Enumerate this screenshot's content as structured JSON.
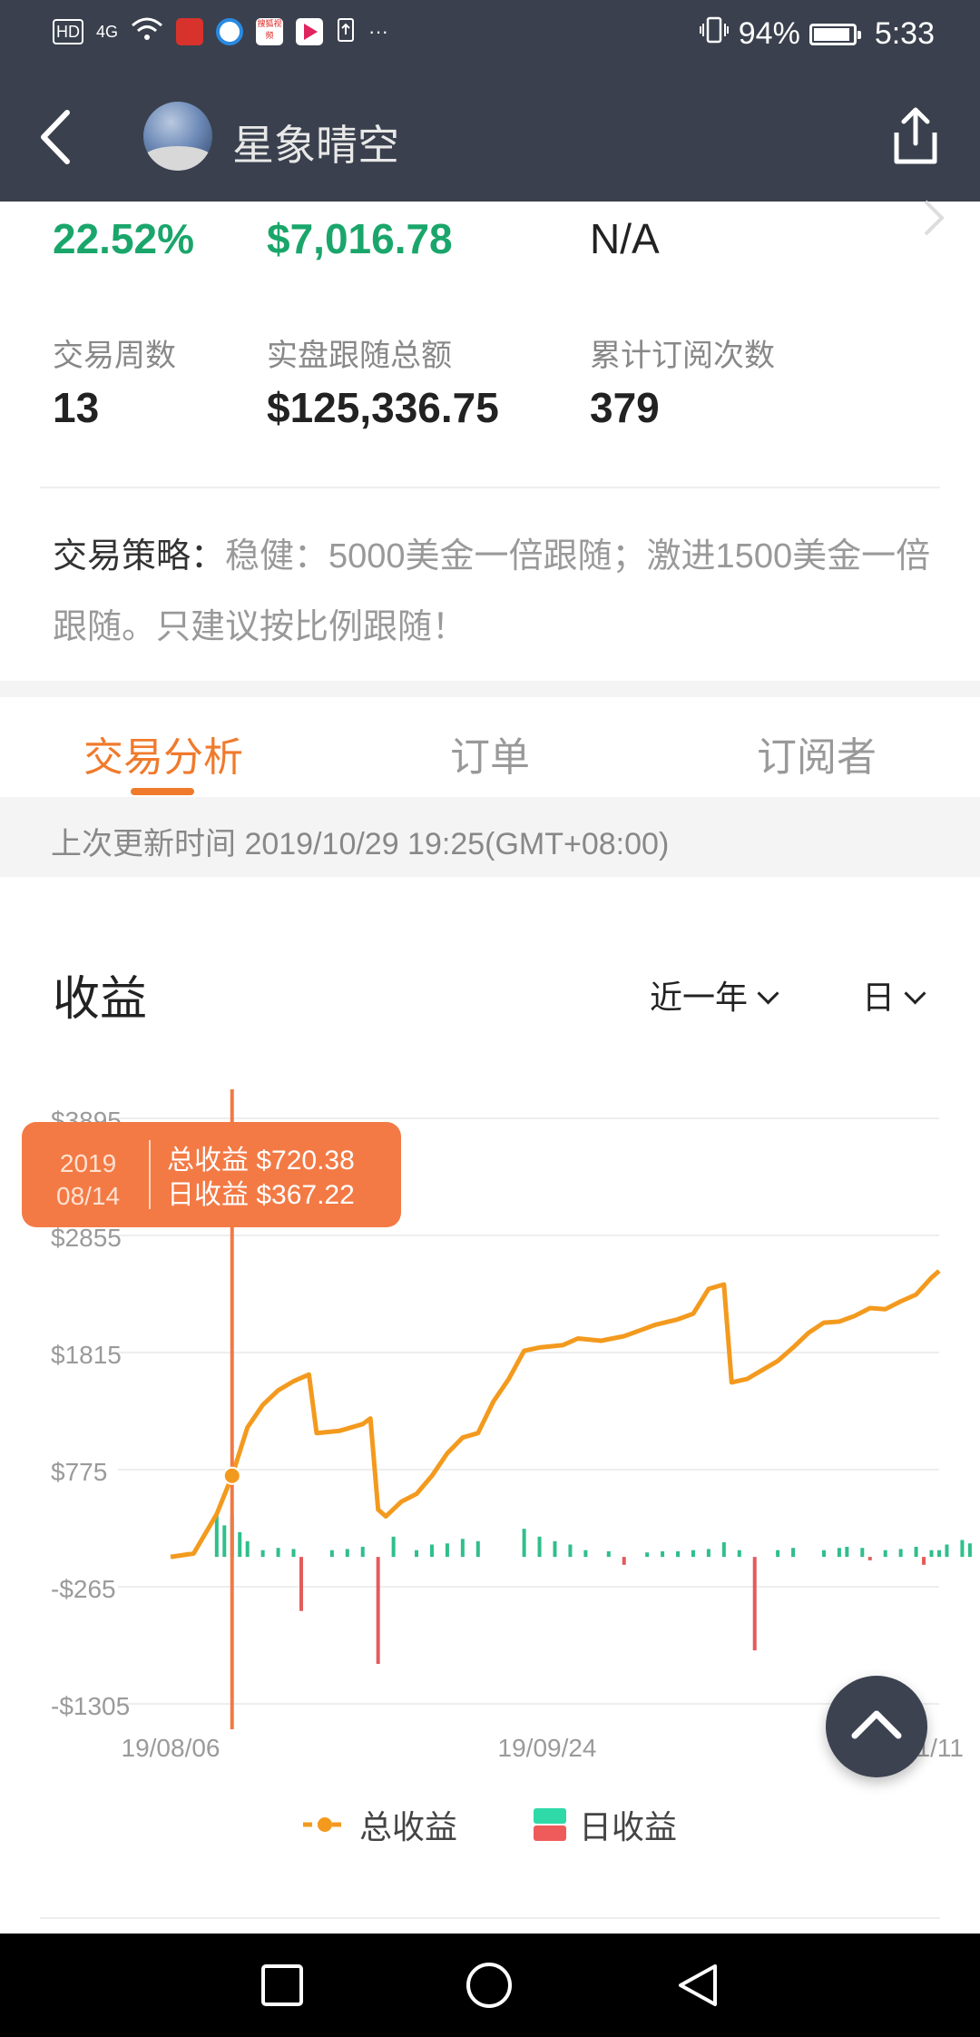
{
  "status_bar": {
    "left_icons": [
      "hd-icon",
      "4g-signal-icon",
      "wifi-icon",
      "stock-app-icon",
      "browser-app-icon",
      "sohu-video-icon",
      "video-app-icon",
      "upload-icon",
      "more-dots-icon"
    ],
    "left_labels": {
      "hd": "HD",
      "net": "4G",
      "sohu": "搜狐视频",
      "more": "···"
    },
    "battery_percent": "94%",
    "battery_level": 0.94,
    "time": "5:33"
  },
  "header": {
    "title": "星象晴空"
  },
  "stats": {
    "row1": [
      "22.52%",
      "$7,016.78",
      "N/A"
    ],
    "row2": [
      {
        "label": "交易周数",
        "value": "13"
      },
      {
        "label": "实盘跟随总额",
        "value": "$125,336.75"
      },
      {
        "label": "累计订阅次数",
        "value": "379"
      }
    ]
  },
  "strategy": {
    "label": "交易策略：",
    "text": "稳健：5000美金一倍跟随；激进1500美金一倍跟随。只建议按比例跟随！"
  },
  "tabs": [
    {
      "label": "交易分析",
      "active": true
    },
    {
      "label": "订单",
      "active": false
    },
    {
      "label": "订阅者",
      "active": false
    }
  ],
  "update_time": "上次更新时间 2019/10/29 19:25(GMT+08:00)",
  "section": {
    "title": "收益",
    "range_select": "近一年",
    "unit_select": "日"
  },
  "tooltip": {
    "date_year": "2019",
    "date_md": "08/14",
    "total_line": "总收益 $720.38",
    "daily_line": "日收益 $367.22"
  },
  "chart_data": {
    "type": "line",
    "y_ticks": [
      "$3895",
      "$2855",
      "$1815",
      "$775",
      "-$265",
      "-$1305"
    ],
    "ylim": [
      -1305,
      3895
    ],
    "x_ticks": [
      "19/08/06",
      "19/09/24",
      "19/11/11"
    ],
    "series": [
      {
        "name": "总收益",
        "color": "#f39a1e",
        "points": [
          [
            "08/06",
            0
          ],
          [
            "08/09",
            30
          ],
          [
            "08/12",
            380
          ],
          [
            "08/14",
            720
          ],
          [
            "08/16",
            1150
          ],
          [
            "08/18",
            1350
          ],
          [
            "08/20",
            1480
          ],
          [
            "08/22",
            1560
          ],
          [
            "08/24",
            1620
          ],
          [
            "08/25",
            1100
          ],
          [
            "08/28",
            1120
          ],
          [
            "08/31",
            1180
          ],
          [
            "09/01",
            1230
          ],
          [
            "09/02",
            420
          ],
          [
            "09/03",
            360
          ],
          [
            "09/05",
            490
          ],
          [
            "09/07",
            560
          ],
          [
            "09/09",
            720
          ],
          [
            "09/11",
            920
          ],
          [
            "09/13",
            1060
          ],
          [
            "09/15",
            1100
          ],
          [
            "09/17",
            1380
          ],
          [
            "09/19",
            1580
          ],
          [
            "09/21",
            1830
          ],
          [
            "09/23",
            1860
          ],
          [
            "09/26",
            1880
          ],
          [
            "09/28",
            1940
          ],
          [
            "10/01",
            1920
          ],
          [
            "10/04",
            1960
          ],
          [
            "10/06",
            2010
          ],
          [
            "10/08",
            2060
          ],
          [
            "10/11",
            2110
          ],
          [
            "10/13",
            2160
          ],
          [
            "10/15",
            2380
          ],
          [
            "10/17",
            2420
          ],
          [
            "10/18",
            1550
          ],
          [
            "10/20",
            1580
          ],
          [
            "10/22",
            1660
          ],
          [
            "10/24",
            1740
          ],
          [
            "10/26",
            1860
          ],
          [
            "10/28",
            1990
          ],
          [
            "10/30",
            2080
          ],
          [
            "11/01",
            2090
          ],
          [
            "11/03",
            2140
          ],
          [
            "11/05",
            2210
          ],
          [
            "11/07",
            2200
          ],
          [
            "11/09",
            2270
          ],
          [
            "11/11",
            2330
          ],
          [
            "11/13",
            2480
          ],
          [
            "11/14",
            2540
          ]
        ]
      },
      {
        "name": "日收益",
        "color_pos": "#2fbf8b",
        "color_neg": "#e35b5b",
        "bars": [
          [
            "08/12",
            370
          ],
          [
            "08/13",
            280
          ],
          [
            "08/14",
            367
          ],
          [
            "08/15",
            220
          ],
          [
            "08/16",
            140
          ],
          [
            "08/18",
            60
          ],
          [
            "08/20",
            80
          ],
          [
            "08/22",
            70
          ],
          [
            "08/23",
            -480
          ],
          [
            "08/27",
            60
          ],
          [
            "08/29",
            70
          ],
          [
            "08/31",
            90
          ],
          [
            "09/02",
            -950
          ],
          [
            "09/04",
            180
          ],
          [
            "09/07",
            60
          ],
          [
            "09/09",
            110
          ],
          [
            "09/11",
            120
          ],
          [
            "09/13",
            160
          ],
          [
            "09/15",
            140
          ],
          [
            "09/21",
            250
          ],
          [
            "09/23",
            180
          ],
          [
            "09/25",
            140
          ],
          [
            "09/27",
            110
          ],
          [
            "09/29",
            60
          ],
          [
            "10/02",
            50
          ],
          [
            "10/04",
            -70
          ],
          [
            "10/07",
            40
          ],
          [
            "10/09",
            50
          ],
          [
            "10/11",
            50
          ],
          [
            "10/13",
            60
          ],
          [
            "10/15",
            70
          ],
          [
            "10/17",
            130
          ],
          [
            "10/19",
            60
          ],
          [
            "10/21",
            -830
          ],
          [
            "10/24",
            60
          ],
          [
            "10/26",
            80
          ],
          [
            "10/30",
            60
          ],
          [
            "11/01",
            80
          ],
          [
            "11/02",
            90
          ],
          [
            "11/04",
            80
          ],
          [
            "11/05",
            -30
          ],
          [
            "11/07",
            60
          ],
          [
            "11/09",
            70
          ],
          [
            "11/11",
            90
          ],
          [
            "11/12",
            -70
          ],
          [
            "11/13",
            60
          ],
          [
            "11/14",
            60
          ],
          [
            "11/15",
            110
          ],
          [
            "11/17",
            150
          ],
          [
            "11/18",
            120
          ]
        ]
      }
    ],
    "legend": [
      "总收益",
      "日收益"
    ],
    "legend_placement": "bottom",
    "grid": true,
    "selected_point": {
      "x": "08/14",
      "total": 720.38,
      "daily": 367.22
    }
  },
  "fab": {
    "icon": "chevron-up-icon"
  },
  "nav": {
    "icons": [
      "square-icon",
      "circle-icon",
      "triangle-back-icon"
    ]
  }
}
